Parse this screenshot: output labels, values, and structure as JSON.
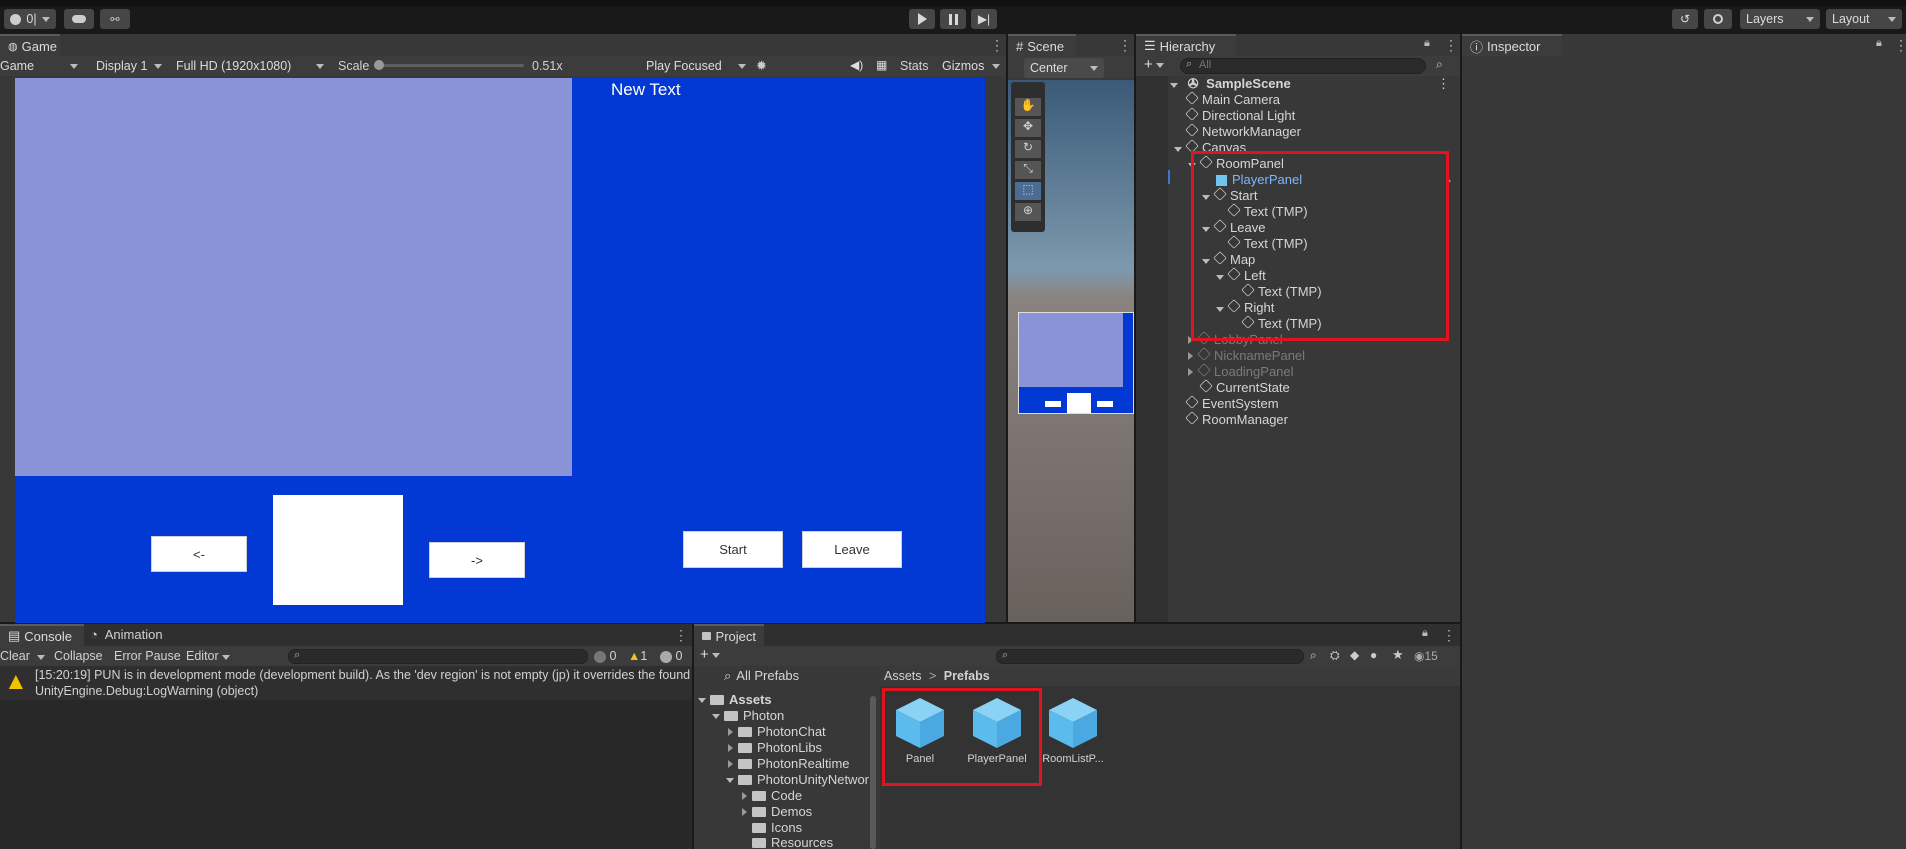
{
  "toolbar": {
    "account_label": "0|",
    "layers_label": "Layers",
    "layout_label": "Layout"
  },
  "game_view": {
    "tab_label": "Game",
    "mode": "Game",
    "display": "Display 1",
    "resolution": "Full HD (1920x1080)",
    "scale_label": "Scale",
    "scale_value": "0.51x",
    "play_mode": "Play Focused",
    "stats_label": "Stats",
    "gizmos_label": "Gizmos",
    "canvas_text": "New Text",
    "left_arrow_btn": "<-",
    "right_arrow_btn": "->",
    "start_btn": "Start",
    "leave_btn": "Leave",
    "bg_color": "#0238d3",
    "panel_color": "#8a93d8"
  },
  "scene_view": {
    "tab_label": "Scene",
    "pivot_label": "Center"
  },
  "hierarchy": {
    "tab_label": "Hierarchy",
    "search_placeholder": "All",
    "scene_name": "SampleScene",
    "items": [
      {
        "label": "Main Camera"
      },
      {
        "label": "Directional Light"
      },
      {
        "label": "NetworkManager"
      },
      {
        "label": "Canvas"
      },
      {
        "label": "RoomPanel"
      },
      {
        "label": "PlayerPanel"
      },
      {
        "label": "Start"
      },
      {
        "label": "Text (TMP)"
      },
      {
        "label": "Leave"
      },
      {
        "label": "Text (TMP)"
      },
      {
        "label": "Map"
      },
      {
        "label": "Left"
      },
      {
        "label": "Text (TMP)"
      },
      {
        "label": "Right"
      },
      {
        "label": "Text (TMP)"
      },
      {
        "label": "LobbyPanel"
      },
      {
        "label": "NicknamePanel"
      },
      {
        "label": "LoadingPanel"
      },
      {
        "label": "CurrentState"
      },
      {
        "label": "EventSystem"
      },
      {
        "label": "RoomManager"
      }
    ]
  },
  "inspector": {
    "tab_label": "Inspector"
  },
  "console": {
    "tab_label": "Console",
    "animation_tab": "Animation",
    "clear_label": "Clear",
    "collapse_label": "Collapse",
    "error_pause_label": "Error Pause",
    "editor_label": "Editor",
    "info_count": "0",
    "warn_count": "1",
    "error_count": "0",
    "log_line1": "[15:20:19] PUN is in development mode (development build). As the 'dev region' is not empty (jp) it overrides the found",
    "log_line2": "UnityEngine.Debug:LogWarning (object)"
  },
  "project": {
    "tab_label": "Project",
    "all_prefabs": "All Prefabs",
    "visible_count": "15",
    "tree": [
      {
        "label": "Assets"
      },
      {
        "label": "Photon"
      },
      {
        "label": "PhotonChat"
      },
      {
        "label": "PhotonLibs"
      },
      {
        "label": "PhotonRealtime"
      },
      {
        "label": "PhotonUnityNetwor"
      },
      {
        "label": "Code"
      },
      {
        "label": "Demos"
      },
      {
        "label": "Icons"
      },
      {
        "label": "Resources"
      }
    ],
    "breadcrumb_root": "Assets",
    "breadcrumb_sep": ">",
    "breadcrumb_current": "Prefabs",
    "assets": [
      {
        "label": "Panel"
      },
      {
        "label": "PlayerPanel"
      },
      {
        "label": "RoomListP..."
      }
    ]
  },
  "highlight_color": "#e0141e"
}
